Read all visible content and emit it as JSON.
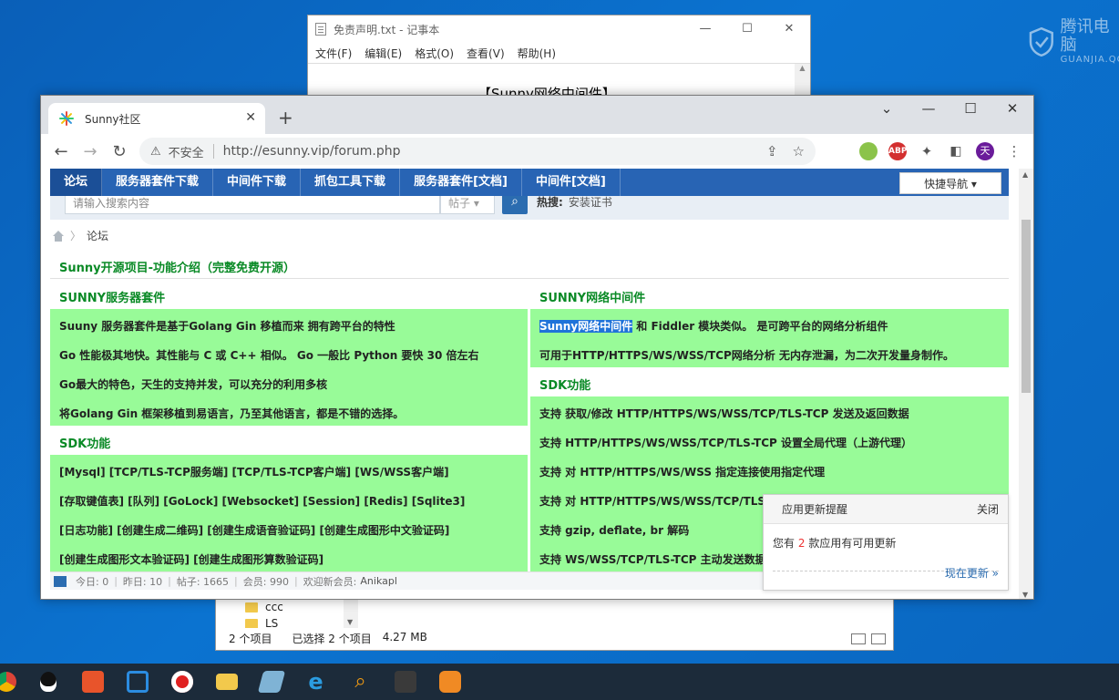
{
  "desktop": {
    "watermark_line1": "腾讯电脑",
    "watermark_line2": "GUANJIA.QQ"
  },
  "notepad": {
    "title": "免责声明.txt - 记事本",
    "menu": [
      "文件(F)",
      "编辑(E)",
      "格式(O)",
      "查看(V)",
      "帮助(H)"
    ],
    "content": "【Sunny网络中间件】"
  },
  "explorer": {
    "folder1": "ccc",
    "folder2": "LS",
    "status_count": "2 个项目",
    "status_selected": "已选择 2 个项目",
    "status_size": "4.27 MB"
  },
  "chrome": {
    "tab_title": "Sunny社区",
    "security_label": "不安全",
    "url": "http://esunny.vip/forum.php",
    "profile_initial": "天",
    "abp_label": "ABP"
  },
  "forum": {
    "nav": [
      "论坛",
      "服务器套件下载",
      "中间件下载",
      "抓包工具下载",
      "服务器套件[文档]",
      "中间件[文档]"
    ],
    "quick_nav": "快捷导航",
    "search_placeholder": "请输入搜索内容",
    "search_type": "帖子",
    "hot_label": "热搜:",
    "hot_tag": "安装证书",
    "breadcrumb": "论坛",
    "section_title": "Sunny开源项目-功能介绍（完整免费开源）",
    "left": {
      "head": "SUNNY服务器套件",
      "lines": [
        "Suuny 服务器套件是基于Golang Gin 移植而来 拥有跨平台的特性",
        "Go 性能极其地快。其性能与 C 或 C++ 相似。 Go 一般比 Python 要快 30 倍左右",
        "Go最大的特色，天生的支持并发，可以充分的利用多核",
        "将Golang Gin 框架移植到易语言，乃至其他语言，都是不错的选择。"
      ],
      "sdk_head": "SDK功能",
      "sdk_lines": [
        "[Mysql] [TCP/TLS-TCP服务端] [TCP/TLS-TCP客户端] [WS/WSS客户端]",
        "[存取键值表] [队列] [GoLock] [Websocket] [Session] [Redis] [Sqlite3]",
        "[日志功能] [创建生成二维码] [创建生成语音验证码] [创建生成图形中文验证码]",
        "[创建生成图形文本验证码] [创建生成图形算数验证码]"
      ]
    },
    "right": {
      "head": "SUNNY网络中间件",
      "line1_highlight": "Sunny网络中间件",
      "line1_rest": " 和 Fiddler 模块类似。 是可跨平台的网络分析组件",
      "line2": "可用于HTTP/HTTPS/WS/WSS/TCP网络分析 无内存泄漏，为二次开发量身制作。",
      "sdk_head": "SDK功能",
      "sdk_lines": [
        "支持 获取/修改 HTTP/HTTPS/WS/WSS/TCP/TLS-TCP 发送及返回数据",
        "支持 HTTP/HTTPS/WS/WSS/TCP/TLS-TCP 设置全局代理（上游代理）",
        "支持 对 HTTP/HTTPS/WS/WSS 指定连接使用指定代理",
        "支持 对 HTTP/HTTPS/WS/WSS/TCP/TLS-",
        "支持 gzip, deflate, br 解码",
        "支持 WS/WSS/TCP/TLS-TCP 主动发送数据"
      ]
    },
    "stats": {
      "today": "今日: 0",
      "yesterday": "昨日: 10",
      "posts": "帖子: 1665",
      "members": "会员: 990",
      "welcome": "欢迎新会员:",
      "new_member": "Anikapl"
    }
  },
  "popup": {
    "title": "应用更新提醒",
    "close": "关闭",
    "msg_prefix": "您有",
    "count": "2",
    "msg_suffix": "款应用有可用更新",
    "action": "现在更新 »"
  },
  "colors": {
    "nav_blue": "#2864b4",
    "green_bg": "#98fb98",
    "heading_green": "#0a8a26",
    "highlight": "#1f73d9"
  }
}
